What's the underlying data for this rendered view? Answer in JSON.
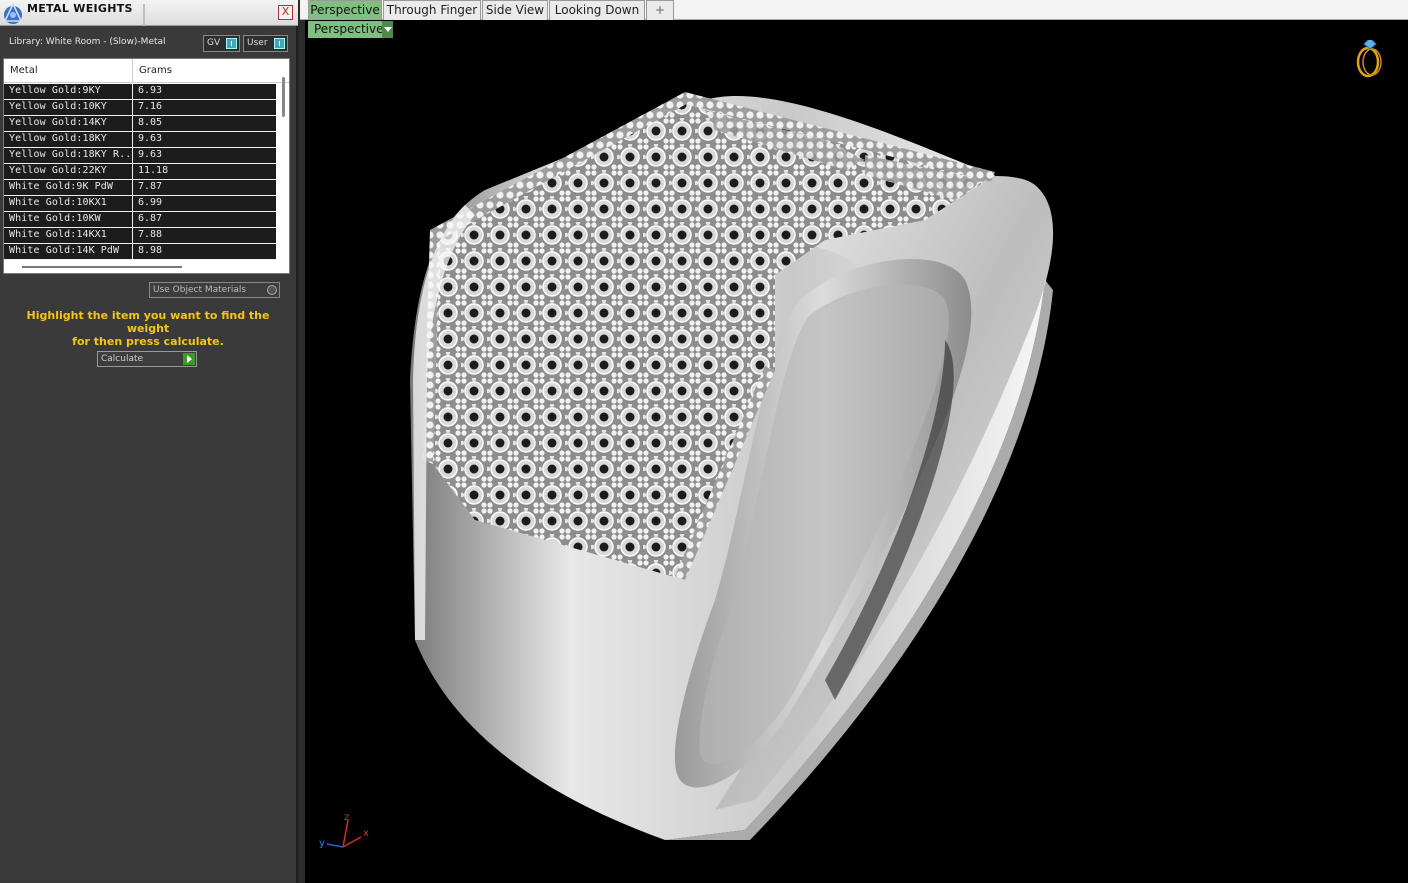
{
  "panel": {
    "title": "METAL WEIGHTS",
    "library_label": "Library: White Room - (Slow)-Metal",
    "gv_label": "GV",
    "user_label": "User",
    "table": {
      "headers": [
        "Metal",
        "Grams"
      ],
      "rows": [
        [
          "Yellow Gold:9KY",
          "6.93"
        ],
        [
          "Yellow Gold:10KY",
          "7.16"
        ],
        [
          "Yellow Gold:14KY",
          "8.05"
        ],
        [
          "Yellow Gold:18KY",
          "9.63"
        ],
        [
          "Yellow Gold:18KY R...",
          "9.63"
        ],
        [
          "Yellow Gold:22KY",
          "11.18"
        ],
        [
          "White Gold:9K PdW",
          "7.87"
        ],
        [
          "White Gold:10KX1",
          "6.99"
        ],
        [
          "White Gold:10KW",
          "6.87"
        ],
        [
          "White Gold:14KX1",
          "7.88"
        ],
        [
          "White Gold:14K PdW",
          "8.98"
        ]
      ]
    },
    "use_object_materials_label": "Use Object Materials",
    "hint_line1": "Highlight the item you want to find the weight",
    "hint_line2": "for then press calculate.",
    "calculate_label": "Calculate",
    "close_glyph": "X"
  },
  "viewport": {
    "tabs": [
      "Perspective",
      "Through Finger",
      "Side View",
      "Looking Down"
    ],
    "active_tab": "Perspective",
    "add_tab_glyph": "+",
    "view_dropdown_label": "Perspective",
    "axis_labels": {
      "x": "x",
      "y": "y",
      "z": "z"
    }
  },
  "colors": {
    "accent_green": "#7fbf7f",
    "hint_yellow": "#f5c518",
    "panel_bg": "#3a3a3a",
    "viewport_bg": "#000000"
  },
  "icons": [
    "app-logo-icon",
    "close-icon",
    "toggle-icon",
    "radio-icon",
    "play-icon",
    "dropdown-arrow-icon",
    "add-tab-icon",
    "ring-nav-icon",
    "axis-triad-icon"
  ]
}
